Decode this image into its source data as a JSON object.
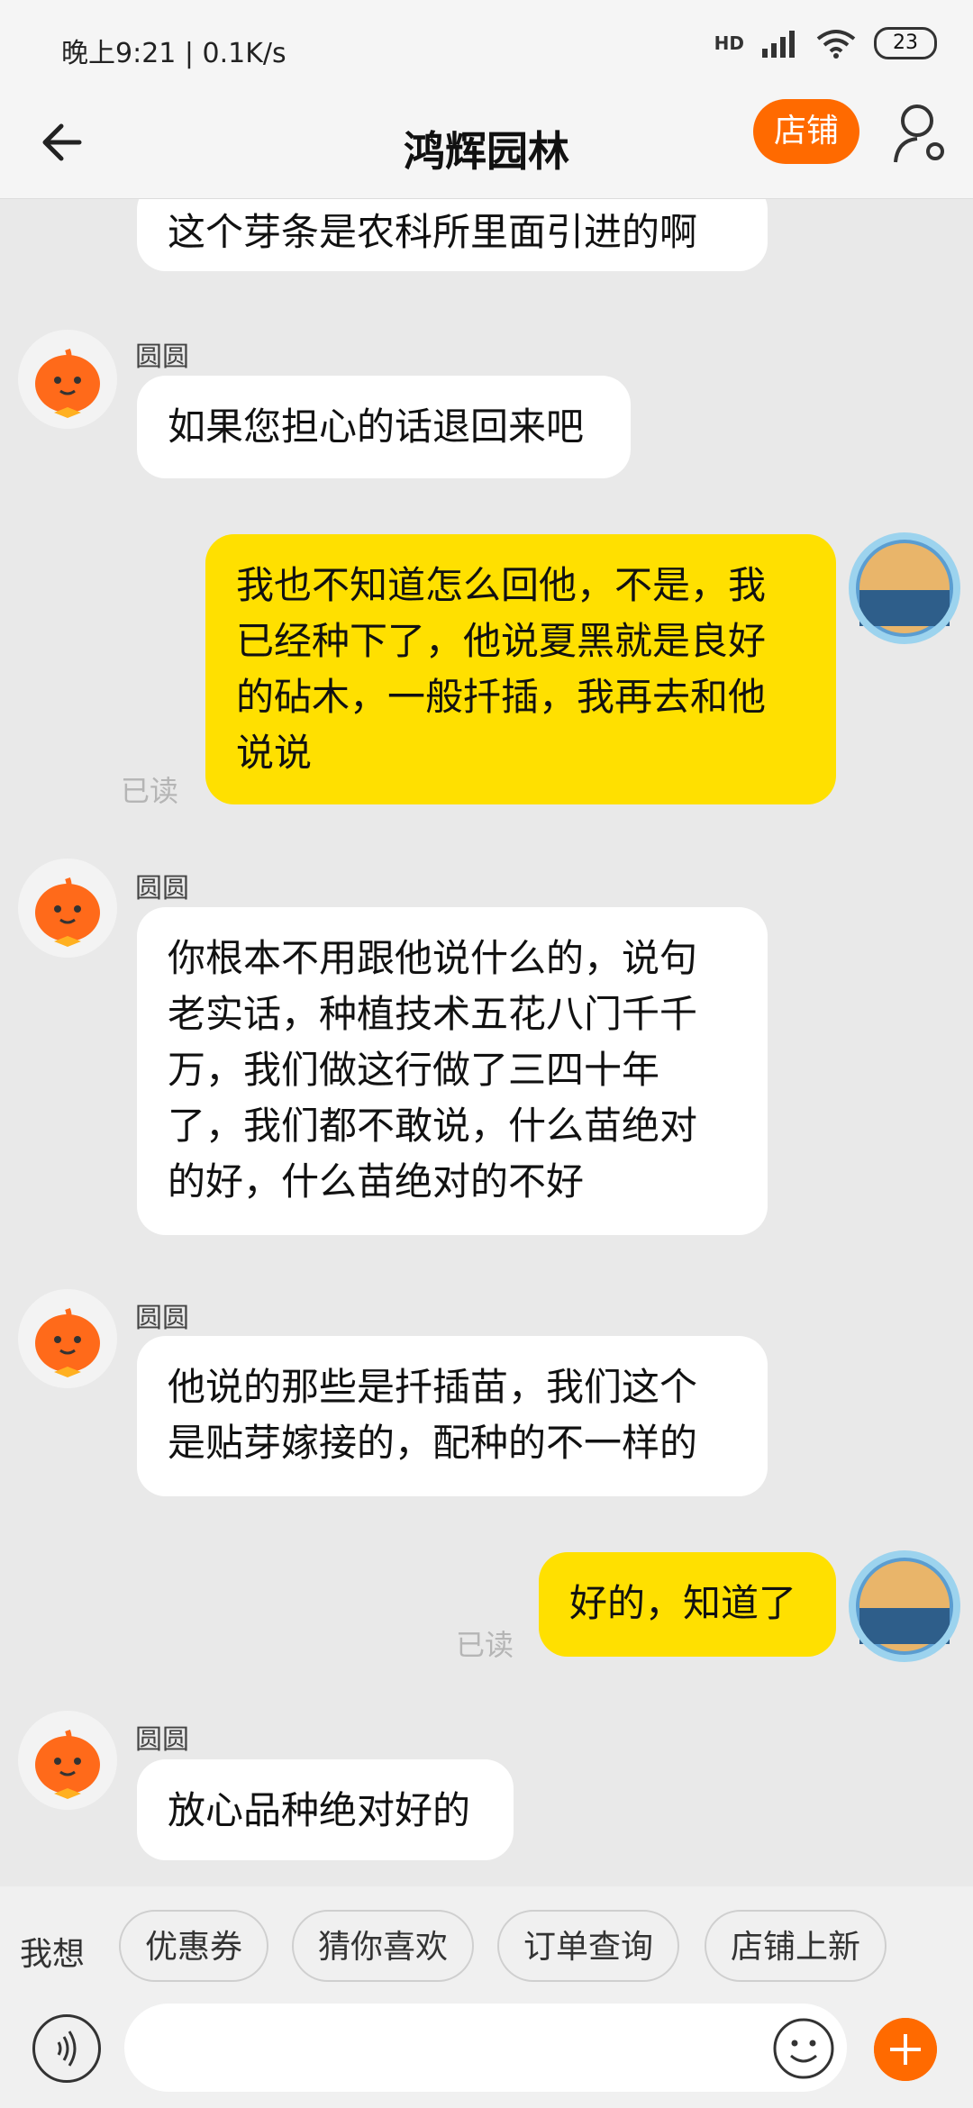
{
  "status_bar": {
    "time": "晚上9:21 | 0.1K/s",
    "network": "HD",
    "battery": "23"
  },
  "header": {
    "title": "鸿辉园林",
    "shop_button": "店铺"
  },
  "colors": {
    "accent": "#ff6a00",
    "outgoing_bubble": "#ffe000",
    "incoming_bubble": "#ffffff"
  },
  "messages": [
    {
      "direction": "in",
      "text": "这个芽条是农科所里面引进的啊"
    },
    {
      "direction": "in",
      "sender": "圆圆",
      "text": "如果您担心的话退回来吧"
    },
    {
      "direction": "out",
      "text": "我也不知道怎么回他，不是，我\n已经种下了，他说夏黑就是良好\n的砧木，一般扦插，我再去和他\n说说",
      "status": "已读"
    },
    {
      "direction": "in",
      "sender": "圆圆",
      "text": "你根本不用跟他说什么的，说句\n老实话，种植技术五花八门千千\n万，我们做这行做了三四十年\n了，我们都不敢说，什么苗绝对\n的好，什么苗绝对的不好"
    },
    {
      "direction": "in",
      "sender": "圆圆",
      "text": "他说的那些是扦插苗，我们这个\n是贴芽嫁接的，配种的不一样的"
    },
    {
      "direction": "out",
      "text": "好的，知道了",
      "status": "已读"
    },
    {
      "direction": "in",
      "sender": "圆圆",
      "text": "放心品种绝对好的"
    }
  ],
  "quick_bar": {
    "label": "我想",
    "chips": [
      "优惠券",
      "猜你喜欢",
      "订单查询",
      "店铺上新"
    ]
  },
  "input": {
    "placeholder": ""
  },
  "icons": {
    "back": "arrow-left-icon",
    "profile": "user-settings-icon",
    "voice": "voice-icon",
    "emoji": "emoji-icon",
    "plus": "plus-icon"
  }
}
